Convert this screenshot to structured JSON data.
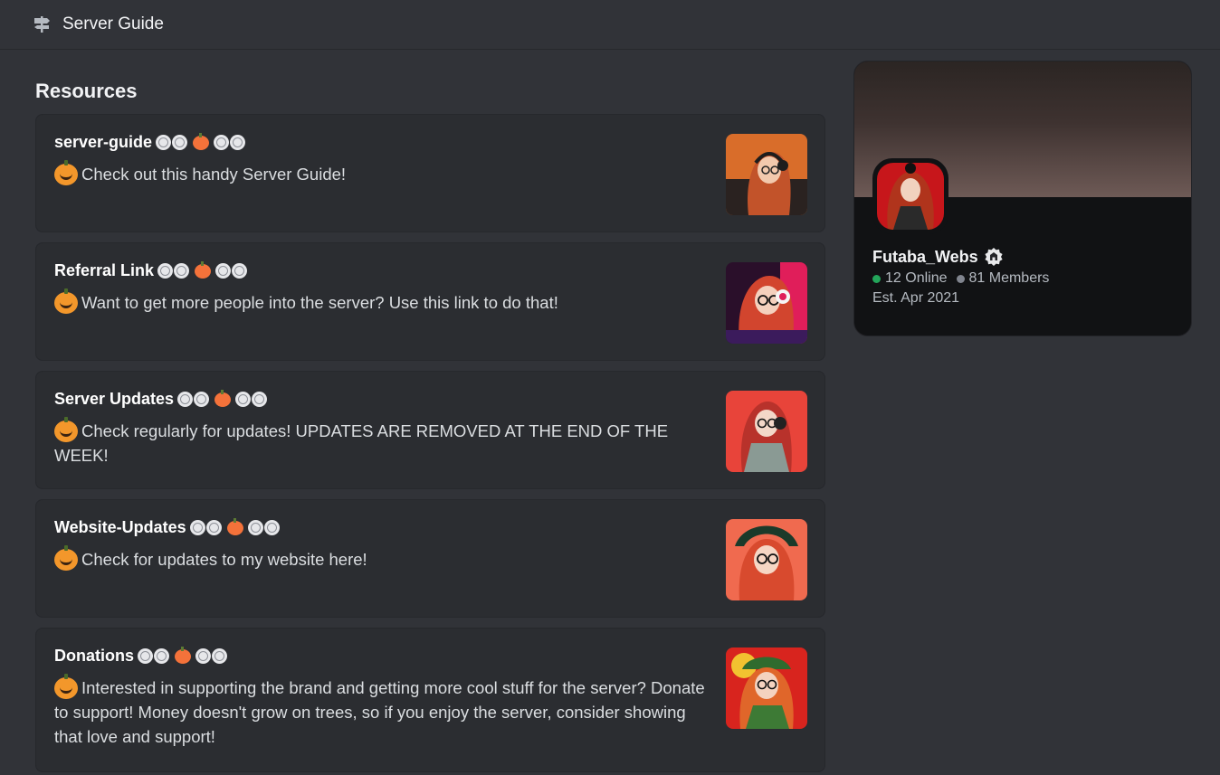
{
  "header": {
    "title": "Server Guide",
    "icon": "signpost-icon"
  },
  "section_title": "Resources",
  "resources": [
    {
      "title": "server-guide",
      "description": "Check out this handy Server Guide!",
      "thumbnail": "anime-avatar-orange"
    },
    {
      "title": "Referral Link",
      "description": "Want to get more people into the server? Use this link to do that!",
      "thumbnail": "anime-avatar-pink"
    },
    {
      "title": "Server Updates",
      "description": "Check regularly for updates! UPDATES ARE REMOVED AT THE END OF THE WEEK!",
      "thumbnail": "anime-avatar-red"
    },
    {
      "title": "Website-Updates",
      "description": "Check for updates to my website here!",
      "thumbnail": "anime-avatar-coral"
    },
    {
      "title": "Donations",
      "description": "Interested in supporting the brand and getting more cool stuff for the server? Donate to support! Money doesn't grow on trees, so if you enjoy the server, consider showing that love and support!",
      "thumbnail": "anime-avatar-green"
    }
  ],
  "server": {
    "name": "Futaba_Webs",
    "online": "12 Online",
    "members": "81 Members",
    "established": "Est. Apr 2021",
    "colors": {
      "online": "#23a55a",
      "members": "#80848e"
    }
  }
}
